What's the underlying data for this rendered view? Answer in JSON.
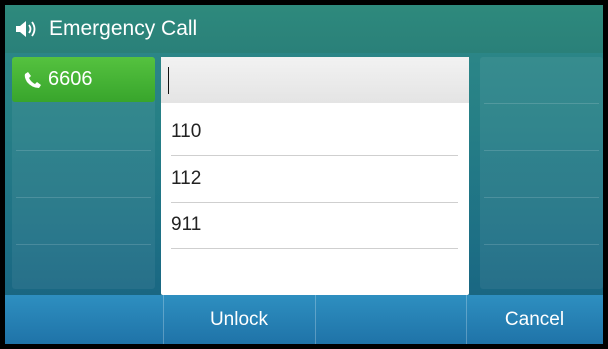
{
  "header": {
    "title": "Emergency Call",
    "icon": "speaker-icon"
  },
  "line_keys": [
    {
      "label": "6606",
      "icon": "phone-icon",
      "color": "#45b335"
    }
  ],
  "dropdown": {
    "input_value": "",
    "items": [
      "110",
      "112",
      "911"
    ]
  },
  "softkeys": [
    "",
    "Unlock",
    "",
    "Cancel"
  ]
}
